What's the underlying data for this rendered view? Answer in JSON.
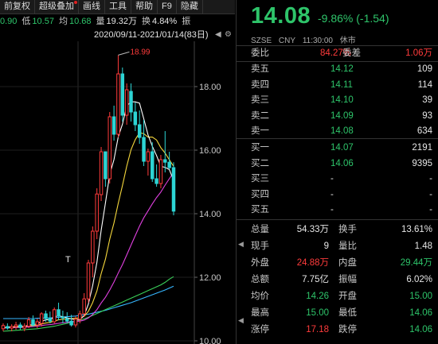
{
  "toolbar": {
    "items": [
      "前复权",
      "超级叠加",
      "画线",
      "工具",
      "帮助",
      "F9",
      "隐藏"
    ]
  },
  "quote": {
    "open_partial": "0.90",
    "low_label": "低",
    "low": "10.57",
    "avg_label": "均",
    "avg": "10.68",
    "vol_label": "量",
    "vol": "19.32万",
    "turn_label": "换",
    "turn": "4.84%",
    "amp_label": "振"
  },
  "range": {
    "text": "2020/09/11-2021/01/14(83日)",
    "arrow": "◀",
    "gear": "⚙"
  },
  "chart_data": {
    "type": "candlestick",
    "y_ticks": [
      "18.00",
      "16.00",
      "14.00",
      "12.00",
      "10.00"
    ],
    "ylim": [
      10.0,
      19.2
    ],
    "peak_label": "18.99",
    "t_marker": "T",
    "colors": {
      "up": "#ff3b3b",
      "down": "#2dd4d4",
      "ma5": "#ffffff",
      "ma10": "#f5d73c",
      "ma20": "#e040e0",
      "ma60": "#3ad15a",
      "ma120": "#36b6ff"
    },
    "candles": [
      {
        "o": 10.38,
        "h": 10.55,
        "l": 10.3,
        "c": 10.48
      },
      {
        "o": 10.45,
        "h": 10.55,
        "l": 10.35,
        "c": 10.4
      },
      {
        "o": 10.4,
        "h": 10.52,
        "l": 10.3,
        "c": 10.45
      },
      {
        "o": 10.45,
        "h": 10.6,
        "l": 10.35,
        "c": 10.5
      },
      {
        "o": 10.5,
        "h": 10.58,
        "l": 10.35,
        "c": 10.42
      },
      {
        "o": 10.4,
        "h": 10.55,
        "l": 10.3,
        "c": 10.46
      },
      {
        "o": 10.46,
        "h": 10.75,
        "l": 10.4,
        "c": 10.66
      },
      {
        "o": 10.66,
        "h": 10.8,
        "l": 10.45,
        "c": 10.5
      },
      {
        "o": 10.5,
        "h": 10.7,
        "l": 10.4,
        "c": 10.6
      },
      {
        "o": 10.55,
        "h": 10.9,
        "l": 10.45,
        "c": 10.85
      },
      {
        "o": 10.85,
        "h": 10.95,
        "l": 10.6,
        "c": 10.7
      },
      {
        "o": 10.7,
        "h": 10.92,
        "l": 10.55,
        "c": 10.62
      },
      {
        "o": 10.6,
        "h": 11.05,
        "l": 10.55,
        "c": 10.98
      },
      {
        "o": 10.98,
        "h": 11.2,
        "l": 10.65,
        "c": 10.78
      },
      {
        "o": 10.75,
        "h": 10.95,
        "l": 10.55,
        "c": 10.72
      },
      {
        "o": 10.7,
        "h": 10.9,
        "l": 10.55,
        "c": 10.62
      },
      {
        "o": 10.62,
        "h": 10.82,
        "l": 10.45,
        "c": 10.5
      },
      {
        "o": 10.5,
        "h": 10.78,
        "l": 10.42,
        "c": 10.68
      },
      {
        "o": 10.68,
        "h": 10.95,
        "l": 10.55,
        "c": 10.85
      },
      {
        "o": 10.85,
        "h": 11.5,
        "l": 10.75,
        "c": 11.32
      },
      {
        "o": 11.32,
        "h": 12.55,
        "l": 11.2,
        "c": 12.45
      },
      {
        "o": 12.45,
        "h": 13.6,
        "l": 12.0,
        "c": 13.45
      },
      {
        "o": 13.45,
        "h": 14.8,
        "l": 13.2,
        "c": 14.62
      },
      {
        "o": 14.6,
        "h": 16.1,
        "l": 14.4,
        "c": 15.95
      },
      {
        "o": 15.95,
        "h": 15.9,
        "l": 14.85,
        "c": 15.1
      },
      {
        "o": 15.1,
        "h": 17.2,
        "l": 14.95,
        "c": 17.05
      },
      {
        "o": 17.05,
        "h": 17.4,
        "l": 16.3,
        "c": 16.5
      },
      {
        "o": 16.5,
        "h": 18.99,
        "l": 16.4,
        "c": 18.4
      },
      {
        "o": 18.4,
        "h": 18.6,
        "l": 16.9,
        "c": 17.1
      },
      {
        "o": 17.1,
        "h": 18.1,
        "l": 16.8,
        "c": 17.9
      },
      {
        "o": 17.85,
        "h": 18.1,
        "l": 16.9,
        "c": 17.2
      },
      {
        "o": 17.2,
        "h": 17.5,
        "l": 16.6,
        "c": 16.8
      },
      {
        "o": 16.8,
        "h": 17.25,
        "l": 16.2,
        "c": 16.4
      },
      {
        "o": 16.4,
        "h": 16.95,
        "l": 15.5,
        "c": 15.65
      },
      {
        "o": 15.65,
        "h": 16.05,
        "l": 15.2,
        "c": 15.95
      },
      {
        "o": 15.95,
        "h": 16.25,
        "l": 15.0,
        "c": 15.1
      },
      {
        "o": 15.1,
        "h": 15.55,
        "l": 14.85,
        "c": 14.95
      },
      {
        "o": 14.95,
        "h": 15.85,
        "l": 14.8,
        "c": 15.7
      },
      {
        "o": 15.7,
        "h": 16.6,
        "l": 15.3,
        "c": 15.62
      },
      {
        "o": 15.62,
        "h": 15.95,
        "l": 15.4,
        "c": 15.45
      },
      {
        "o": 15.45,
        "h": 15.62,
        "l": 13.95,
        "c": 14.08
      }
    ],
    "ma": {
      "ma5": [
        10.41,
        10.43,
        10.44,
        10.45,
        10.46,
        10.45,
        10.5,
        10.51,
        10.53,
        10.61,
        10.66,
        10.67,
        10.75,
        10.79,
        10.76,
        10.72,
        10.69,
        10.66,
        10.67,
        10.79,
        11.16,
        11.73,
        12.47,
        13.47,
        14.34,
        15.24,
        15.7,
        16.41,
        16.82,
        17.39,
        17.52,
        17.52,
        17.48,
        16.99,
        16.48,
        16.12,
        15.83,
        15.49,
        15.46,
        15.39,
        15.05
      ],
      "ma10": [
        10.42,
        10.42,
        10.43,
        10.44,
        10.44,
        10.45,
        10.47,
        10.48,
        10.49,
        10.53,
        10.56,
        10.58,
        10.62,
        10.66,
        10.68,
        10.69,
        10.7,
        10.71,
        10.72,
        10.77,
        10.93,
        11.2,
        11.57,
        12.11,
        12.57,
        13.2,
        13.71,
        14.32,
        14.89,
        15.49,
        16.01,
        16.33,
        16.55,
        16.52,
        16.41,
        16.41,
        16.32,
        16.08,
        15.91,
        15.7,
        15.49
      ],
      "ma20": [
        10.4,
        10.41,
        10.41,
        10.42,
        10.42,
        10.43,
        10.44,
        10.45,
        10.46,
        10.48,
        10.5,
        10.51,
        10.53,
        10.55,
        10.57,
        10.58,
        10.6,
        10.61,
        10.62,
        10.65,
        10.72,
        10.83,
        10.98,
        11.19,
        11.37,
        11.6,
        11.85,
        12.13,
        12.4,
        12.7,
        13.01,
        13.31,
        13.61,
        13.87,
        14.09,
        14.31,
        14.51,
        14.68,
        14.9,
        15.1,
        15.3
      ],
      "ma60": [
        10.3,
        10.31,
        10.32,
        10.33,
        10.34,
        10.35,
        10.36,
        10.37,
        10.38,
        10.4,
        10.42,
        10.44,
        10.46,
        10.49,
        10.52,
        10.55,
        10.58,
        10.61,
        10.65,
        10.69,
        10.74,
        10.8,
        10.86,
        10.92,
        10.98,
        11.04,
        11.1,
        11.16,
        11.22,
        11.28,
        11.34,
        11.4,
        11.46,
        11.52,
        11.58,
        11.64,
        11.7,
        11.76,
        11.84,
        11.94,
        12.02
      ],
      "ma120": [
        10.7,
        10.7,
        10.7,
        10.7,
        10.7,
        10.7,
        10.7,
        10.7,
        10.71,
        10.71,
        10.72,
        10.72,
        10.73,
        10.74,
        10.75,
        10.76,
        10.77,
        10.78,
        10.8,
        10.82,
        10.84,
        10.87,
        10.9,
        10.93,
        10.96,
        11.0,
        11.04,
        11.08,
        11.12,
        11.16,
        11.2,
        11.25,
        11.3,
        11.35,
        11.4,
        11.45,
        11.5,
        11.55,
        11.6,
        11.66,
        11.72
      ]
    }
  },
  "stock": {
    "price": "14.08",
    "change": "-9.86%  (-1.54)",
    "exchange": "SZSE",
    "currency": "CNY",
    "time": "11:30:00",
    "status": "休市"
  },
  "weibi": {
    "label1": "委比",
    "value1": "84.27%",
    "label2": "委差",
    "value2": "1.06万"
  },
  "asks": [
    {
      "label": "卖五",
      "price": "14.12",
      "vol": "109"
    },
    {
      "label": "卖四",
      "price": "14.11",
      "vol": "114"
    },
    {
      "label": "卖三",
      "price": "14.10",
      "vol": "39"
    },
    {
      "label": "卖二",
      "price": "14.09",
      "vol": "93"
    },
    {
      "label": "卖一",
      "price": "14.08",
      "vol": "634"
    }
  ],
  "bids": [
    {
      "label": "买一",
      "price": "14.07",
      "vol": "2191"
    },
    {
      "label": "买二",
      "price": "14.06",
      "vol": "9395"
    },
    {
      "label": "买三",
      "price": "-",
      "vol": "-"
    },
    {
      "label": "买四",
      "price": "-",
      "vol": "-"
    },
    {
      "label": "买五",
      "price": "-",
      "vol": "-"
    }
  ],
  "stats": [
    {
      "l1": "总量",
      "v1": "54.33万",
      "c1": "white",
      "l2": "换手",
      "v2": "13.61%",
      "c2": "white"
    },
    {
      "l1": "现手",
      "v1": "9",
      "c1": "white",
      "l2": "量比",
      "v2": "1.48",
      "c2": "white"
    },
    {
      "l1": "外盘",
      "v1": "24.88万",
      "c1": "red",
      "l2": "内盘",
      "v2": "29.44万",
      "c2": "green"
    },
    {
      "l1": "总额",
      "v1": "7.75亿",
      "c1": "white",
      "l2": "振幅",
      "v2": "6.02%",
      "c2": "white"
    },
    {
      "l1": "均价",
      "v1": "14.26",
      "c1": "green",
      "l2": "开盘",
      "v2": "15.00",
      "c2": "green"
    },
    {
      "l1": "最高",
      "v1": "15.00",
      "c1": "green",
      "l2": "最低",
      "v2": "14.06",
      "c2": "green"
    },
    {
      "l1": "涨停",
      "v1": "17.18",
      "c1": "red",
      "l2": "跌停",
      "v2": "14.06",
      "c2": "green"
    }
  ],
  "side_marks": [
    "◀",
    "◀"
  ]
}
